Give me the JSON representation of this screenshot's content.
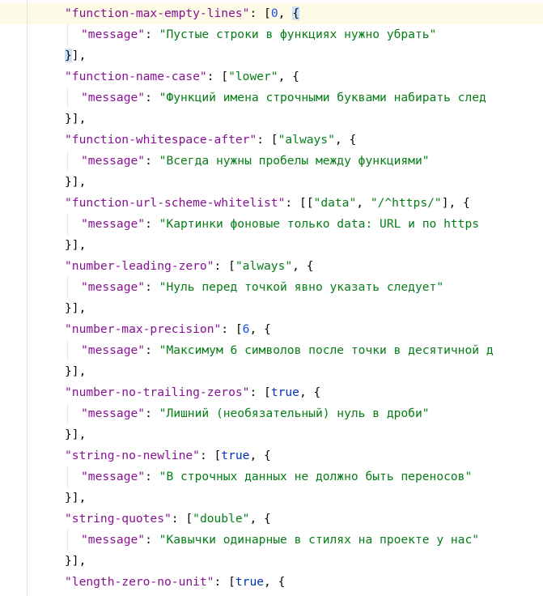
{
  "editor": {
    "lines": [
      {
        "indent": 1,
        "tokens": [
          {
            "k": "key",
            "t": "\"function-max-empty-lines\""
          },
          {
            "k": "pun",
            "t": ": ["
          },
          {
            "k": "num",
            "t": "0"
          },
          {
            "k": "pun",
            "t": ", "
          },
          {
            "k": "hl",
            "t": "{"
          }
        ]
      },
      {
        "indent": 2,
        "tokens": [
          {
            "k": "key",
            "t": "\"message\""
          },
          {
            "k": "pun",
            "t": ": "
          },
          {
            "k": "str",
            "t": "\"Пустые строки в функциях нужно убрать\""
          }
        ]
      },
      {
        "indent": 1,
        "tokens": [
          {
            "k": "hl",
            "t": "}"
          },
          {
            "k": "pun",
            "t": "],"
          }
        ]
      },
      {
        "indent": 1,
        "tokens": [
          {
            "k": "key",
            "t": "\"function-name-case\""
          },
          {
            "k": "pun",
            "t": ": ["
          },
          {
            "k": "str",
            "t": "\"lower\""
          },
          {
            "k": "pun",
            "t": ", {"
          }
        ]
      },
      {
        "indent": 2,
        "tokens": [
          {
            "k": "key",
            "t": "\"message\""
          },
          {
            "k": "pun",
            "t": ": "
          },
          {
            "k": "str",
            "t": "\"Функций имена строчными буквами набирать след"
          }
        ]
      },
      {
        "indent": 1,
        "tokens": [
          {
            "k": "pun",
            "t": "}],"
          }
        ]
      },
      {
        "indent": 1,
        "tokens": [
          {
            "k": "key",
            "t": "\"function-whitespace-after\""
          },
          {
            "k": "pun",
            "t": ": ["
          },
          {
            "k": "str",
            "t": "\"always\""
          },
          {
            "k": "pun",
            "t": ", {"
          }
        ]
      },
      {
        "indent": 2,
        "tokens": [
          {
            "k": "key",
            "t": "\"message\""
          },
          {
            "k": "pun",
            "t": ": "
          },
          {
            "k": "str",
            "t": "\"Всегда нужны пробелы между функциями\""
          }
        ]
      },
      {
        "indent": 1,
        "tokens": [
          {
            "k": "pun",
            "t": "}],"
          }
        ]
      },
      {
        "indent": 1,
        "tokens": [
          {
            "k": "key",
            "t": "\"function-url-scheme-whitelist\""
          },
          {
            "k": "pun",
            "t": ": [["
          },
          {
            "k": "str",
            "t": "\"data\""
          },
          {
            "k": "pun",
            "t": ", "
          },
          {
            "k": "str",
            "t": "\"/^https/\""
          },
          {
            "k": "pun",
            "t": "], {"
          }
        ]
      },
      {
        "indent": 2,
        "tokens": [
          {
            "k": "key",
            "t": "\"message\""
          },
          {
            "k": "pun",
            "t": ": "
          },
          {
            "k": "str",
            "t": "\"Картинки фоновые только data: URL и по https"
          }
        ]
      },
      {
        "indent": 1,
        "tokens": [
          {
            "k": "pun",
            "t": "}],"
          }
        ]
      },
      {
        "indent": 1,
        "tokens": [
          {
            "k": "key",
            "t": "\"number-leading-zero\""
          },
          {
            "k": "pun",
            "t": ": ["
          },
          {
            "k": "str",
            "t": "\"always\""
          },
          {
            "k": "pun",
            "t": ", {"
          }
        ]
      },
      {
        "indent": 2,
        "tokens": [
          {
            "k": "key",
            "t": "\"message\""
          },
          {
            "k": "pun",
            "t": ": "
          },
          {
            "k": "str",
            "t": "\"Нуль перед точкой явно указать следует\""
          }
        ]
      },
      {
        "indent": 1,
        "tokens": [
          {
            "k": "pun",
            "t": "}],"
          }
        ]
      },
      {
        "indent": 1,
        "tokens": [
          {
            "k": "key",
            "t": "\"number-max-precision\""
          },
          {
            "k": "pun",
            "t": ": ["
          },
          {
            "k": "num",
            "t": "6"
          },
          {
            "k": "pun",
            "t": ", {"
          }
        ]
      },
      {
        "indent": 2,
        "tokens": [
          {
            "k": "key",
            "t": "\"message\""
          },
          {
            "k": "pun",
            "t": ": "
          },
          {
            "k": "str",
            "t": "\"Максимум 6 символов после точки в десятичной д"
          }
        ]
      },
      {
        "indent": 1,
        "tokens": [
          {
            "k": "pun",
            "t": "}],"
          }
        ]
      },
      {
        "indent": 1,
        "tokens": [
          {
            "k": "key",
            "t": "\"number-no-trailing-zeros\""
          },
          {
            "k": "pun",
            "t": ": ["
          },
          {
            "k": "kw",
            "t": "true"
          },
          {
            "k": "pun",
            "t": ", {"
          }
        ]
      },
      {
        "indent": 2,
        "tokens": [
          {
            "k": "key",
            "t": "\"message\""
          },
          {
            "k": "pun",
            "t": ": "
          },
          {
            "k": "str",
            "t": "\"Лишний (необязательный) нуль в дроби\""
          }
        ]
      },
      {
        "indent": 1,
        "tokens": [
          {
            "k": "pun",
            "t": "}],"
          }
        ]
      },
      {
        "indent": 1,
        "tokens": [
          {
            "k": "key",
            "t": "\"string-no-newline\""
          },
          {
            "k": "pun",
            "t": ": ["
          },
          {
            "k": "kw",
            "t": "true"
          },
          {
            "k": "pun",
            "t": ", {"
          }
        ]
      },
      {
        "indent": 2,
        "tokens": [
          {
            "k": "key",
            "t": "\"message\""
          },
          {
            "k": "pun",
            "t": ": "
          },
          {
            "k": "str",
            "t": "\"В строчных данных не должно быть переносов\""
          }
        ]
      },
      {
        "indent": 1,
        "tokens": [
          {
            "k": "pun",
            "t": "}],"
          }
        ]
      },
      {
        "indent": 1,
        "tokens": [
          {
            "k": "key",
            "t": "\"string-quotes\""
          },
          {
            "k": "pun",
            "t": ": ["
          },
          {
            "k": "str",
            "t": "\"double\""
          },
          {
            "k": "pun",
            "t": ", {"
          }
        ]
      },
      {
        "indent": 2,
        "tokens": [
          {
            "k": "key",
            "t": "\"message\""
          },
          {
            "k": "pun",
            "t": ": "
          },
          {
            "k": "str",
            "t": "\"Кавычки одинарные в стилях на проекте у нас\""
          }
        ]
      },
      {
        "indent": 1,
        "tokens": [
          {
            "k": "pun",
            "t": "}],"
          }
        ]
      },
      {
        "indent": 1,
        "tokens": [
          {
            "k": "key",
            "t": "\"length-zero-no-unit\""
          },
          {
            "k": "pun",
            "t": ": ["
          },
          {
            "k": "kw",
            "t": "true"
          },
          {
            "k": "pun",
            "t": ", {"
          }
        ]
      }
    ]
  },
  "colors": {
    "key": "#871094",
    "string": "#067d17",
    "number": "#1750eb",
    "keyword": "#0033b3",
    "punctuation": "#080808",
    "brace_highlight": "#cbe0f5",
    "current_line": "#fdfbe6"
  }
}
